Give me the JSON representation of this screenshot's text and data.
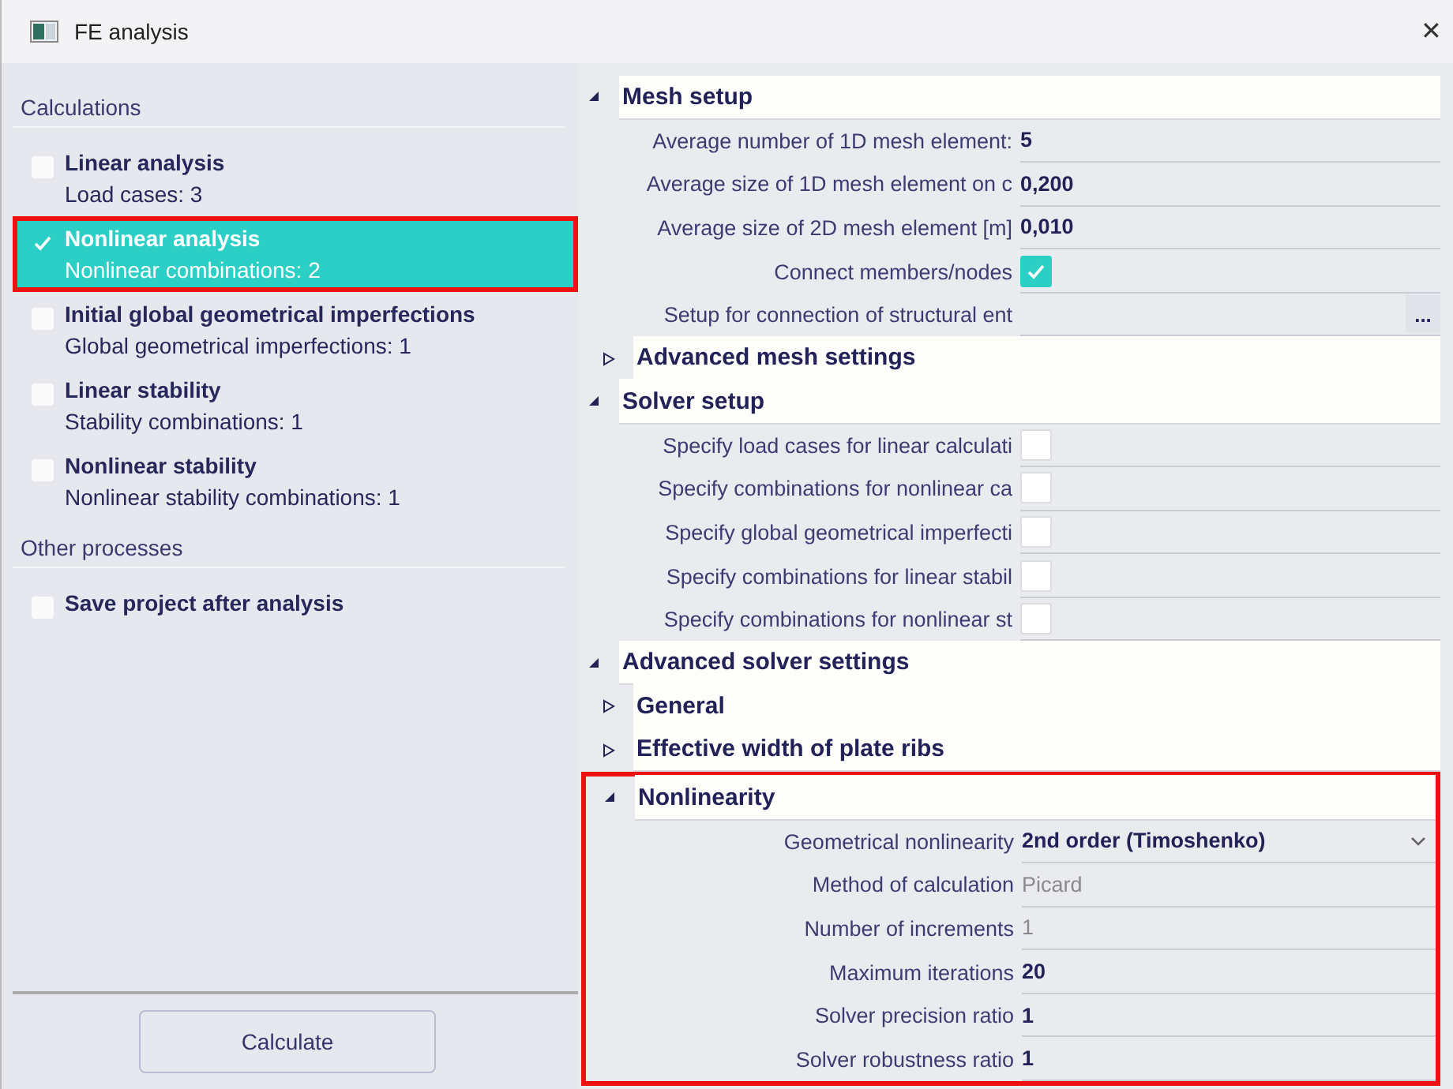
{
  "window": {
    "title": "FE analysis",
    "close": "✕"
  },
  "calculations": {
    "heading": "Calculations",
    "items": [
      {
        "title": "Linear analysis",
        "detail": "Load cases: 3",
        "selected": false,
        "highlighted": false
      },
      {
        "title": "Nonlinear analysis",
        "detail": "Nonlinear combinations: 2",
        "selected": true,
        "highlighted": true
      },
      {
        "title": "Initial global geometrical imperfections",
        "detail": "Global geometrical imperfections: 1",
        "selected": false,
        "highlighted": false
      },
      {
        "title": "Linear stability",
        "detail": "Stability combinations: 1",
        "selected": false,
        "highlighted": false
      },
      {
        "title": "Nonlinear stability",
        "detail": "Nonlinear stability combinations: 1",
        "selected": false,
        "highlighted": false
      }
    ]
  },
  "other_processes": {
    "heading": "Other processes",
    "items": [
      {
        "title": "Save project after analysis",
        "checked": false
      }
    ]
  },
  "calculate_button": "Calculate",
  "properties": [
    {
      "kind": "group",
      "title": "Mesh setup",
      "expanded": true,
      "highlighted": false,
      "children": [
        {
          "kind": "text",
          "label": "Average number of 1D mesh element:",
          "value": "5",
          "disabled": false
        },
        {
          "kind": "text",
          "label": "Average size of 1D mesh element on c",
          "value": "0,200",
          "disabled": false
        },
        {
          "kind": "text",
          "label": "Average size of 2D mesh element [m]",
          "value": "0,010",
          "disabled": false
        },
        {
          "kind": "checkbox",
          "label": "Connect members/nodes",
          "checked": true
        },
        {
          "kind": "button",
          "label": "Setup for connection of structural ent",
          "button": "..."
        },
        {
          "kind": "group",
          "title": "Advanced mesh settings",
          "expanded": false,
          "highlighted": false
        }
      ]
    },
    {
      "kind": "group",
      "title": "Solver setup",
      "expanded": true,
      "highlighted": false,
      "children": [
        {
          "kind": "checkbox",
          "label": "Specify load cases for linear calculati",
          "checked": false
        },
        {
          "kind": "checkbox",
          "label": "Specify combinations for nonlinear ca",
          "checked": false
        },
        {
          "kind": "checkbox",
          "label": "Specify global geometrical imperfecti",
          "checked": false
        },
        {
          "kind": "checkbox",
          "label": "Specify combinations for linear stabil",
          "checked": false
        },
        {
          "kind": "checkbox",
          "label": "Specify combinations for nonlinear st",
          "checked": false
        }
      ]
    },
    {
      "kind": "group",
      "title": "Advanced solver settings",
      "expanded": true,
      "highlighted": false,
      "children": [
        {
          "kind": "group",
          "title": "General",
          "expanded": false,
          "highlighted": false
        },
        {
          "kind": "group",
          "title": "Effective width of plate ribs",
          "expanded": false,
          "highlighted": false
        },
        {
          "kind": "group",
          "title": "Nonlinearity",
          "expanded": true,
          "highlighted": true,
          "children": [
            {
              "kind": "dropdown",
              "label": "Geometrical nonlinearity",
              "value": "2nd order (Timoshenko)",
              "disabled": false
            },
            {
              "kind": "text",
              "label": "Method of calculation",
              "value": "Picard",
              "disabled": true
            },
            {
              "kind": "text",
              "label": "Number of increments",
              "value": "1",
              "disabled": true
            },
            {
              "kind": "text",
              "label": "Maximum iterations",
              "value": "20",
              "disabled": false
            },
            {
              "kind": "text",
              "label": "Solver precision ratio",
              "value": "1",
              "disabled": false
            },
            {
              "kind": "text",
              "label": "Solver robustness ratio",
              "value": "1",
              "disabled": false
            }
          ]
        }
      ]
    }
  ]
}
